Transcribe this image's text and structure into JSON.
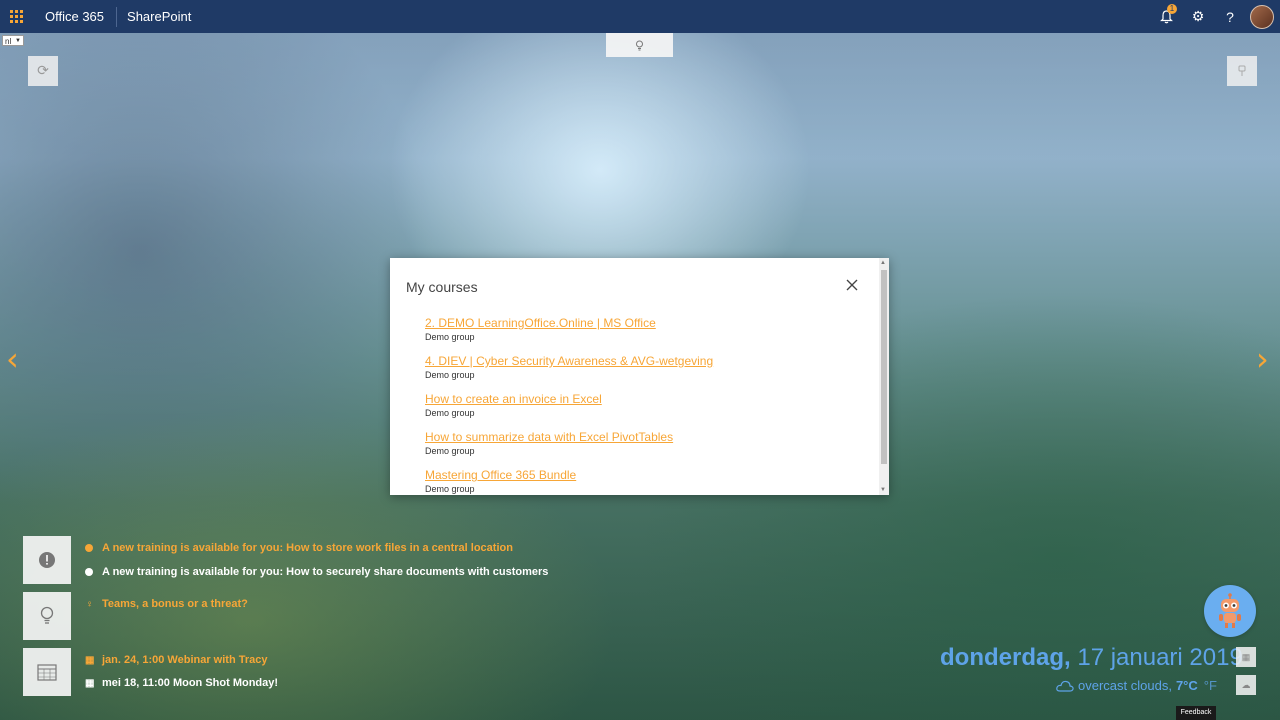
{
  "topbar": {
    "brand": "Office 365",
    "app": "SharePoint",
    "notification_count": "1",
    "help_label": "?"
  },
  "language": {
    "selected": "nl"
  },
  "dialog": {
    "title": "My courses",
    "courses": [
      {
        "title": "2. DEMO LearningOffice.Online | MS Office",
        "group": "Demo group"
      },
      {
        "title": "4. DIEV | Cyber Security Awareness & AVG-wetgeving",
        "group": "Demo group"
      },
      {
        "title": "How to create an invoice in Excel",
        "group": "Demo group"
      },
      {
        "title": "How to summarize data with Excel PivotTables",
        "group": "Demo group"
      },
      {
        "title": "Mastering Office 365 Bundle",
        "group": "Demo group"
      }
    ]
  },
  "notifications": [
    {
      "text": "A new training is available for you: How to store work files in a central location",
      "color": "#f7a637"
    },
    {
      "text": "A new training is available for you: How to securely share documents with customers",
      "color": "#ffffff"
    }
  ],
  "tips": [
    {
      "text": "Teams, a bonus or a threat?"
    }
  ],
  "events": [
    {
      "text": "jan. 24, 1:00 Webinar with Tracy"
    },
    {
      "text": "mei 18, 11:00 Moon Shot Monday!"
    }
  ],
  "date": {
    "weekday": "donderdag,",
    "date": "17 januari 2019"
  },
  "weather": {
    "description": "overcast clouds,",
    "temp": "7°C",
    "unit_alt": "°F"
  },
  "feedback": {
    "label": "Feedback"
  },
  "colors": {
    "accent": "#f7a637",
    "topbar": "#1f3a66",
    "date_blue": "#5ea3e8"
  }
}
